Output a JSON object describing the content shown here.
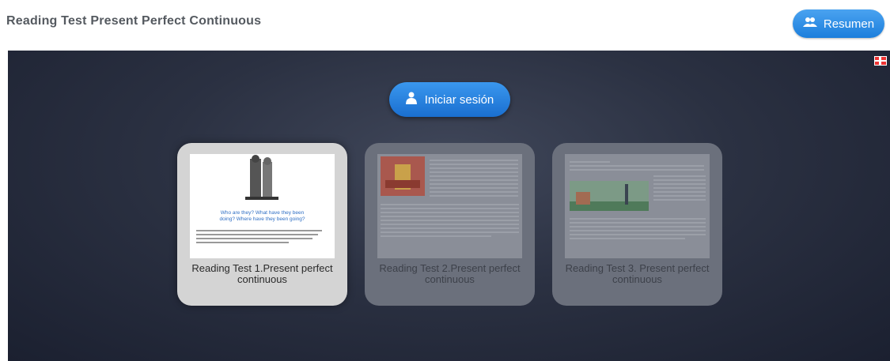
{
  "page": {
    "title": "Reading Test Present Perfect Continuous"
  },
  "header": {
    "summary_button": "Resumen"
  },
  "stage": {
    "login_button": "Iniciar sesión",
    "cards": [
      {
        "label": "Reading Test 1.Present perfect continuous",
        "state": "active",
        "thumb_heading": "Who are they? What have they been doing? Where have they been going?"
      },
      {
        "label": "Reading Test 2.Present perfect continuous",
        "state": "locked"
      },
      {
        "label": "Reading Test 3. Present perfect continuous",
        "state": "locked"
      }
    ]
  }
}
